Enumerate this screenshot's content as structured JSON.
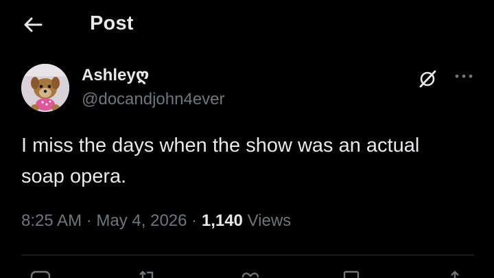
{
  "header": {
    "title": "Post",
    "back_icon": "arrow-left-icon"
  },
  "author": {
    "display_name": "Ashleyღ",
    "handle": "@docandjohn4ever",
    "avatar": "dog-photo-avatar"
  },
  "post": {
    "text": "I miss the days when the show was an actual soap opera.",
    "time": "8:25 AM",
    "separator": "·",
    "date": "May 4, 2026",
    "views_count": "1,140",
    "views_label": "Views"
  },
  "toolbar": {
    "grok_icon": "grok-icon",
    "more_icon": "more-horizontal-icon"
  },
  "actions": {
    "icons": [
      "reply-icon",
      "repost-icon",
      "like-icon",
      "bookmark-icon",
      "share-icon"
    ]
  },
  "colors": {
    "background": "#000000",
    "primary_text": "#e7e9ea",
    "secondary_text": "#71767b",
    "divider": "#2f3336"
  }
}
